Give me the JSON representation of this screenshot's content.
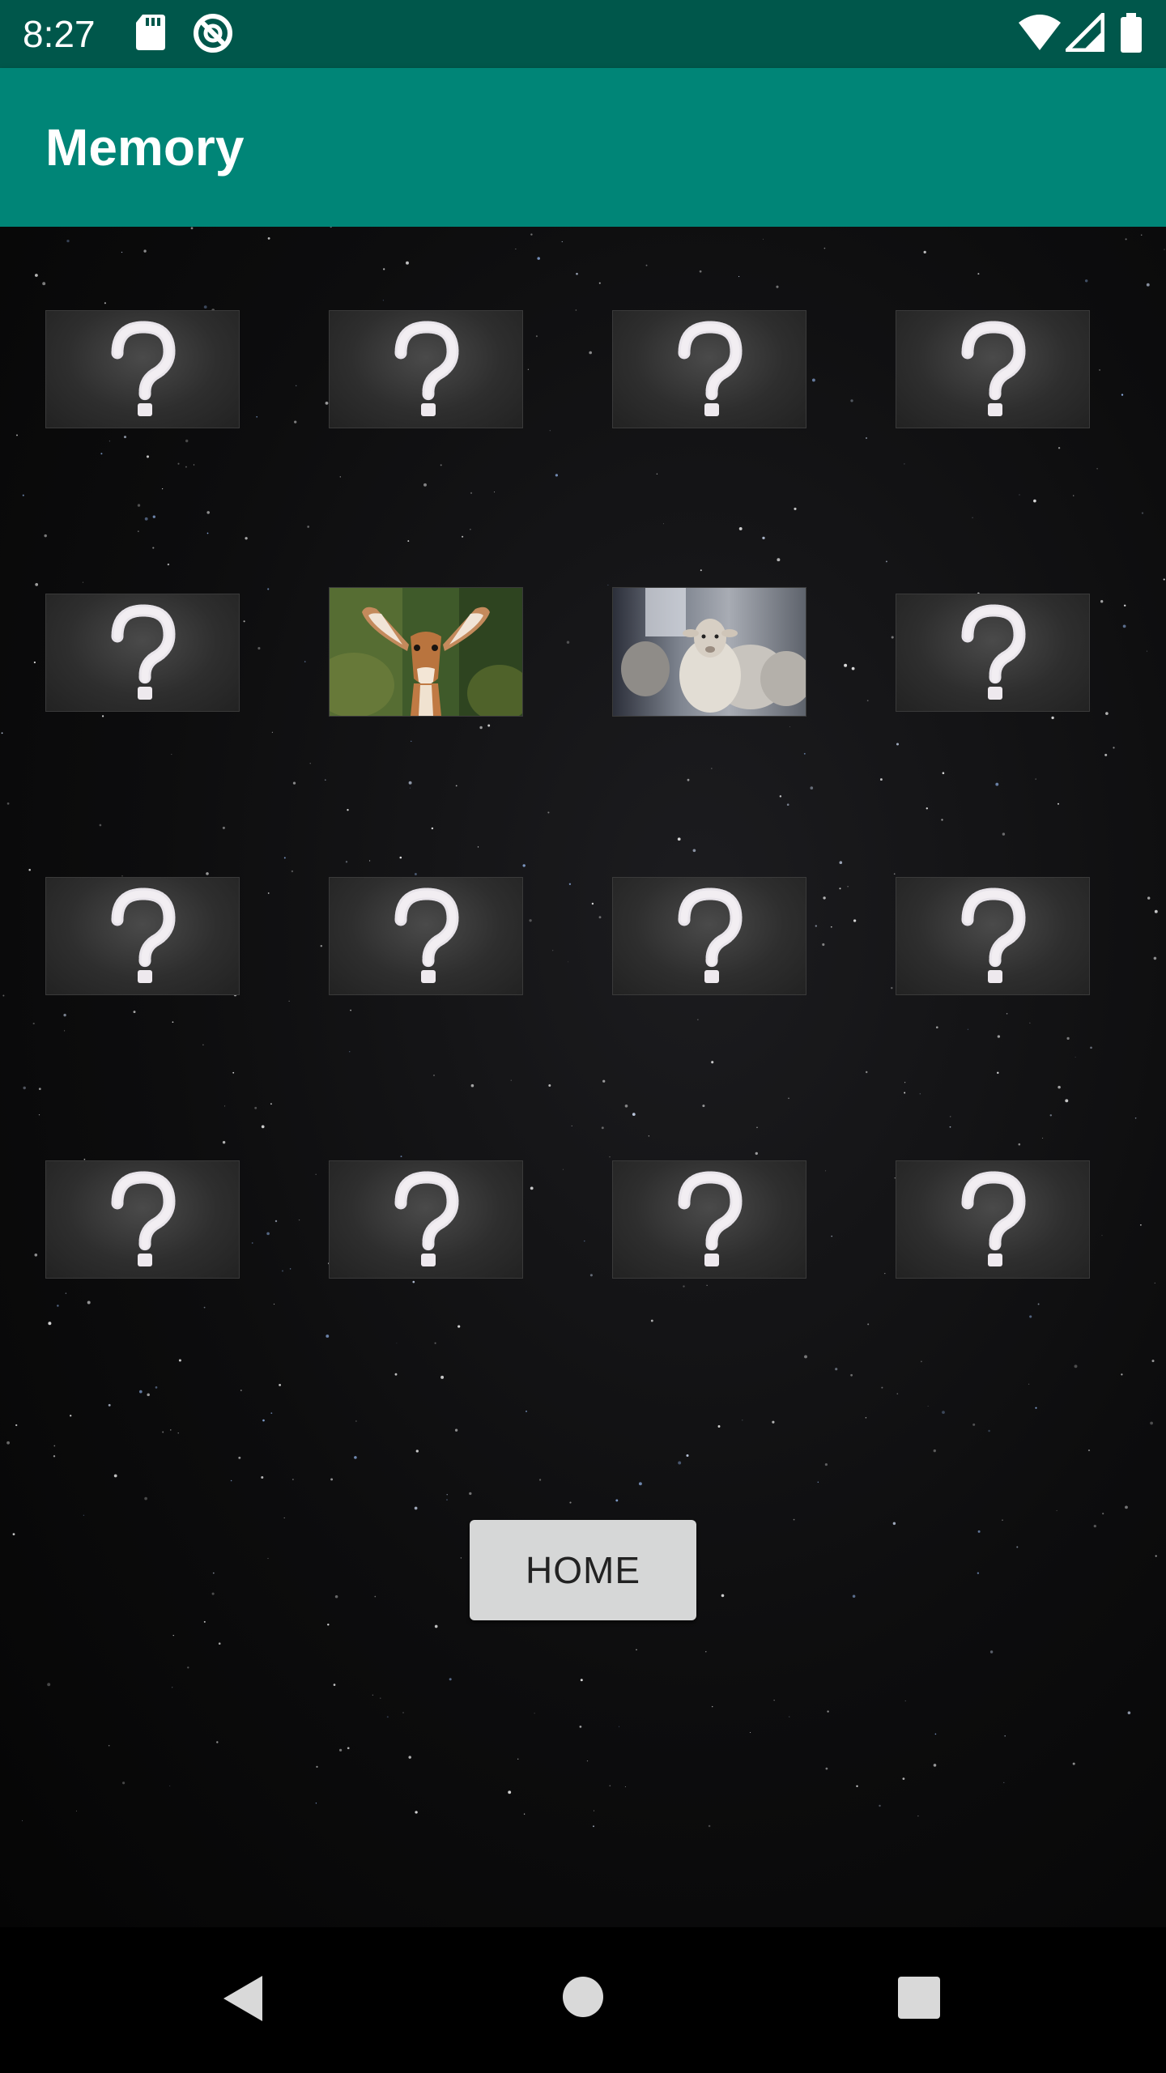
{
  "status_bar": {
    "time": "8:27",
    "icons_left": [
      "sd-card-icon",
      "data-saver-icon"
    ],
    "icons_right": [
      "wifi-icon",
      "cell-signal-icon",
      "battery-icon"
    ]
  },
  "app_bar": {
    "title": "Memory"
  },
  "board": {
    "rows": 4,
    "cols": 4,
    "cards": [
      {
        "state": "hidden",
        "symbol": "?"
      },
      {
        "state": "hidden",
        "symbol": "?"
      },
      {
        "state": "hidden",
        "symbol": "?"
      },
      {
        "state": "hidden",
        "symbol": "?"
      },
      {
        "state": "hidden",
        "symbol": "?"
      },
      {
        "state": "revealed",
        "image": "gazelle"
      },
      {
        "state": "revealed",
        "image": "sheep"
      },
      {
        "state": "hidden",
        "symbol": "?"
      },
      {
        "state": "hidden",
        "symbol": "?"
      },
      {
        "state": "hidden",
        "symbol": "?"
      },
      {
        "state": "hidden",
        "symbol": "?"
      },
      {
        "state": "hidden",
        "symbol": "?"
      },
      {
        "state": "hidden",
        "symbol": "?"
      },
      {
        "state": "hidden",
        "symbol": "?"
      },
      {
        "state": "hidden",
        "symbol": "?"
      },
      {
        "state": "hidden",
        "symbol": "?"
      }
    ]
  },
  "home_button": {
    "label": "HOME"
  },
  "nav_bar": {
    "icons": [
      "back-icon",
      "home-circle-icon",
      "recents-icon"
    ]
  },
  "colors": {
    "status_bar": "#00574b",
    "app_bar": "#008577",
    "button": "#d6d7d7"
  }
}
